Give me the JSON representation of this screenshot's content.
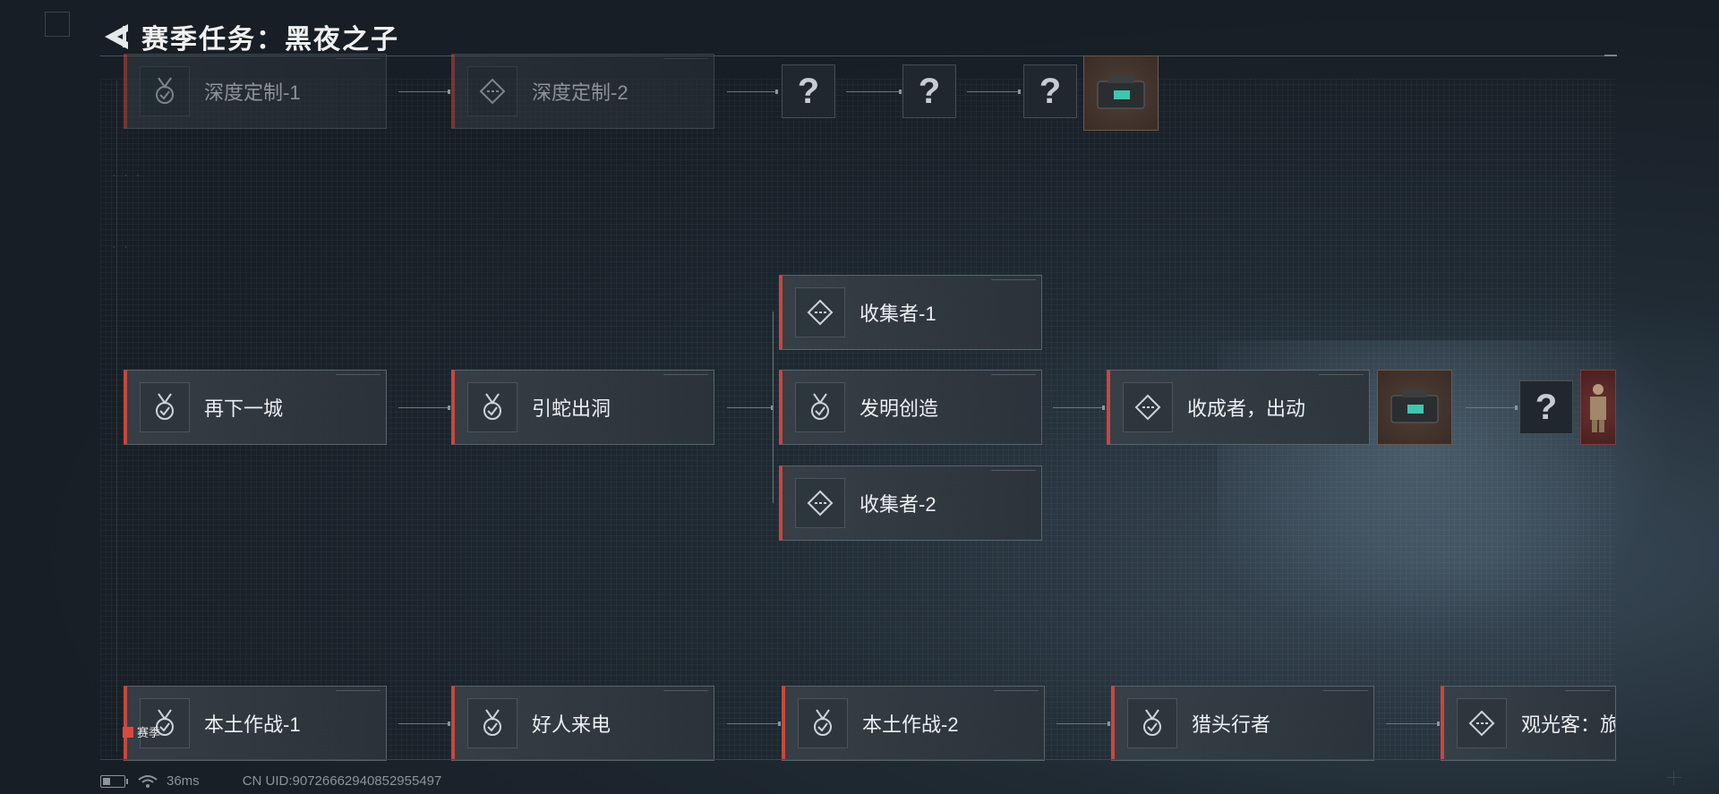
{
  "header": {
    "title": "赛季任务：黑夜之子"
  },
  "tasks": {
    "r1_1": "深度定制-1",
    "r1_2": "深度定制-2",
    "r2_1": "再下一城",
    "r2_2": "引蛇出洞",
    "r2_3a": "收集者-1",
    "r2_3b": "发明创造",
    "r2_3c": "收集者-2",
    "r2_4": "收成者，出动",
    "r3_1": "本土作战-1",
    "r3_2": "好人来电",
    "r3_3": "本土作战-2",
    "r3_4": "猎头行者",
    "r3_5": "观光客：旅"
  },
  "unknown_mark": "?",
  "season_tag": "赛季",
  "status": {
    "ping": "36ms",
    "uid": "CN UID:9072666294085295​5497"
  },
  "colors": {
    "accent": "#c8473d",
    "background": "#171e25"
  },
  "icons": {
    "medal": "medal-check-icon",
    "diamond": "diamond-task-icon",
    "back": "back-arrow-icon",
    "reward_box": "weapon-case-icon",
    "reward_outfit": "outfit-icon"
  }
}
